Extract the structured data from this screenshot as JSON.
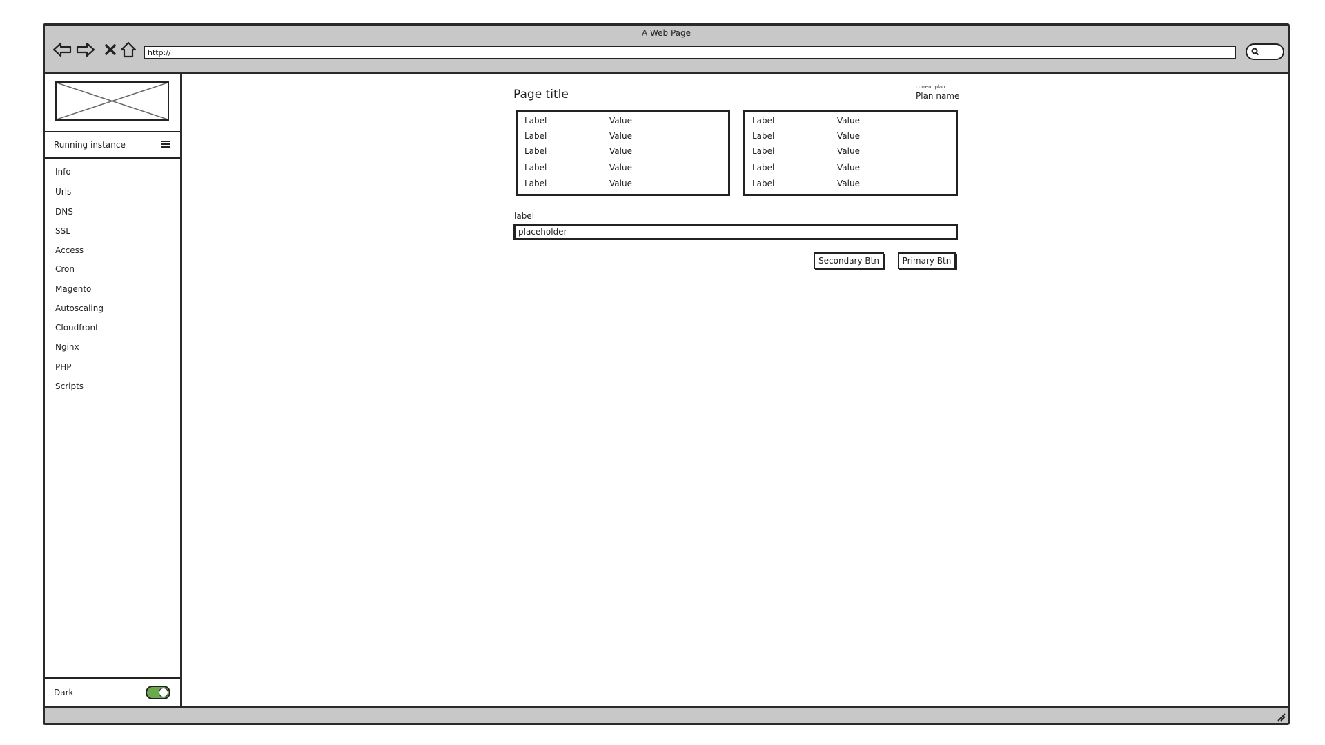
{
  "window": {
    "title": "A Web Page"
  },
  "browser": {
    "url": "http://"
  },
  "sidebar": {
    "instance_label": "Running instance",
    "items": [
      {
        "label": "Info"
      },
      {
        "label": "Urls"
      },
      {
        "label": "DNS"
      },
      {
        "label": "SSL"
      },
      {
        "label": "Access"
      },
      {
        "label": "Cron"
      },
      {
        "label": "Magento"
      },
      {
        "label": "Autoscaling"
      },
      {
        "label": "Cloudfront"
      },
      {
        "label": "Nginx"
      },
      {
        "label": "PHP"
      },
      {
        "label": "Scripts"
      }
    ],
    "footer": {
      "label": "Dark",
      "toggle_on": true
    }
  },
  "main": {
    "page_title": "Page title",
    "plan": {
      "caption": "current plan",
      "name": "Plan name"
    },
    "info_boxes": [
      {
        "rows": [
          {
            "label": "Label",
            "value": "Value"
          },
          {
            "label": "Label",
            "value": "Value"
          },
          {
            "label": "Label",
            "value": "Value"
          },
          {
            "label": "Label",
            "value": "Value"
          },
          {
            "label": "Label",
            "value": "Value"
          }
        ]
      },
      {
        "rows": [
          {
            "label": "Label",
            "value": "Value"
          },
          {
            "label": "Label",
            "value": "Value"
          },
          {
            "label": "Label",
            "value": "Value"
          },
          {
            "label": "Label",
            "value": "Value"
          },
          {
            "label": "Label",
            "value": "Value"
          }
        ]
      }
    ],
    "field": {
      "label": "label",
      "placeholder": "placeholder"
    },
    "buttons": {
      "secondary": "Secondary Btn",
      "primary": "Primary Btn"
    }
  },
  "colors": {
    "toggle_on": "#6aaa4c",
    "chrome": "#c8c8c8"
  }
}
